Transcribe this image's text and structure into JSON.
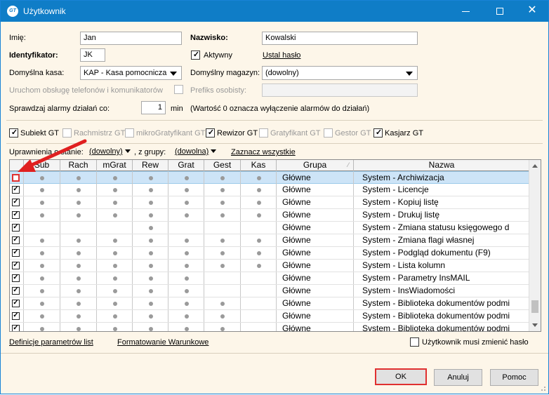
{
  "window": {
    "title": "Użytkownik",
    "icon_text": "GT"
  },
  "form": {
    "imie_label": "Imię:",
    "imie_value": "Jan",
    "nazwisko_label": "Nazwisko:",
    "nazwisko_value": "Kowalski",
    "identyfikator_label": "Identyfikator:",
    "identyfikator_value": "JK",
    "aktywny_label": "Aktywny",
    "ustal_haslo_label": "Ustal hasło",
    "kasa_label": "Domyślna kasa:",
    "kasa_value": "KAP - Kasa pomocnicza",
    "magazyn_label": "Domyślny magazyn:",
    "magazyn_value": "(dowolny)",
    "telefony_label": "Uruchom obsługę telefonów i komunikatorów",
    "prefiks_label": "Prefiks osobisty:",
    "prefiks_value": "",
    "alarmy_label": "Sprawdzaj alarmy działań co:",
    "alarmy_value": "1",
    "alarmy_unit": "min",
    "alarmy_note": "(Wartość 0 oznacza wyłączenie alarmów do działań)"
  },
  "modules": [
    {
      "label": "Subiekt GT",
      "checked": true,
      "enabled": true
    },
    {
      "label": "Rachmistrz GT",
      "checked": false,
      "enabled": false
    },
    {
      "label": "mikroGratyfikant GT",
      "checked": false,
      "enabled": false
    },
    {
      "label": "Rewizor GT",
      "checked": true,
      "enabled": true
    },
    {
      "label": "Gratyfikant GT",
      "checked": false,
      "enabled": false
    },
    {
      "label": "Gestor GT",
      "checked": false,
      "enabled": false
    },
    {
      "label": "Kasjarz GT",
      "checked": true,
      "enabled": true
    }
  ],
  "filters": {
    "stan_label": "Uprawnienia o stanie:",
    "stan_value": "(dowolny)",
    "grupa_label": ", z grupy:",
    "grupa_value": "(dowolna)",
    "zaznacz_label": "Zaznacz wszystkie"
  },
  "grid": {
    "columns": [
      "Sub",
      "Rach",
      "mGrat",
      "Rew",
      "Grat",
      "Gest",
      "Kas",
      "Grupa",
      "Nazwa"
    ],
    "rows": [
      {
        "checked": false,
        "dots": [
          1,
          1,
          1,
          1,
          1,
          1,
          1
        ],
        "grupa": "Główne",
        "nazwa": "System - Archiwizacja",
        "selected": true
      },
      {
        "checked": true,
        "dots": [
          1,
          1,
          1,
          1,
          1,
          1,
          1
        ],
        "grupa": "Główne",
        "nazwa": "System - Licencje"
      },
      {
        "checked": true,
        "dots": [
          1,
          1,
          1,
          1,
          1,
          1,
          1
        ],
        "grupa": "Główne",
        "nazwa": "System - Kopiuj listę"
      },
      {
        "checked": true,
        "dots": [
          1,
          1,
          1,
          1,
          1,
          1,
          1
        ],
        "grupa": "Główne",
        "nazwa": "System - Drukuj listę"
      },
      {
        "checked": true,
        "dots": [
          0,
          0,
          0,
          1,
          0,
          0,
          0
        ],
        "grupa": "Główne",
        "nazwa": "System - Zmiana statusu księgowego d"
      },
      {
        "checked": true,
        "dots": [
          1,
          1,
          1,
          1,
          1,
          1,
          1
        ],
        "grupa": "Główne",
        "nazwa": "System - Zmiana flagi własnej"
      },
      {
        "checked": true,
        "dots": [
          1,
          1,
          1,
          1,
          1,
          1,
          1
        ],
        "grupa": "Główne",
        "nazwa": "System - Podgląd dokumentu (F9)"
      },
      {
        "checked": true,
        "dots": [
          1,
          1,
          1,
          1,
          1,
          1,
          1
        ],
        "grupa": "Główne",
        "nazwa": "System - Lista kolumn"
      },
      {
        "checked": true,
        "dots": [
          1,
          1,
          1,
          1,
          1,
          0,
          0
        ],
        "grupa": "Główne",
        "nazwa": "System - Parametry InsMAIL"
      },
      {
        "checked": true,
        "dots": [
          1,
          1,
          1,
          1,
          1,
          0,
          0
        ],
        "grupa": "Główne",
        "nazwa": "System - InsWiadomości"
      },
      {
        "checked": true,
        "dots": [
          1,
          1,
          1,
          1,
          1,
          1,
          0
        ],
        "grupa": "Główne",
        "nazwa": "System - Biblioteka dokumentów podmi"
      },
      {
        "checked": true,
        "dots": [
          1,
          1,
          1,
          1,
          1,
          1,
          0
        ],
        "grupa": "Główne",
        "nazwa": "System - Biblioteka dokumentów podmi"
      },
      {
        "checked": true,
        "dots": [
          1,
          1,
          1,
          1,
          1,
          1,
          0
        ],
        "grupa": "Główne",
        "nazwa": "System - Biblioteka dokumentów podmi"
      }
    ]
  },
  "footer": {
    "definicje_label": "Definicje parametrów list",
    "formatowanie_label": "Formatowanie Warunkowe",
    "zmien_haslo_label": "Użytkownik musi zmienić hasło"
  },
  "buttons": {
    "ok": "OK",
    "anuluj": "Anuluj",
    "pomoc": "Pomoc"
  },
  "colors": {
    "titlebar": "#0f7dc7",
    "highlight": "#e03030",
    "selected_row": "#cde4f7",
    "dialog_bg": "#fdf6e9"
  }
}
